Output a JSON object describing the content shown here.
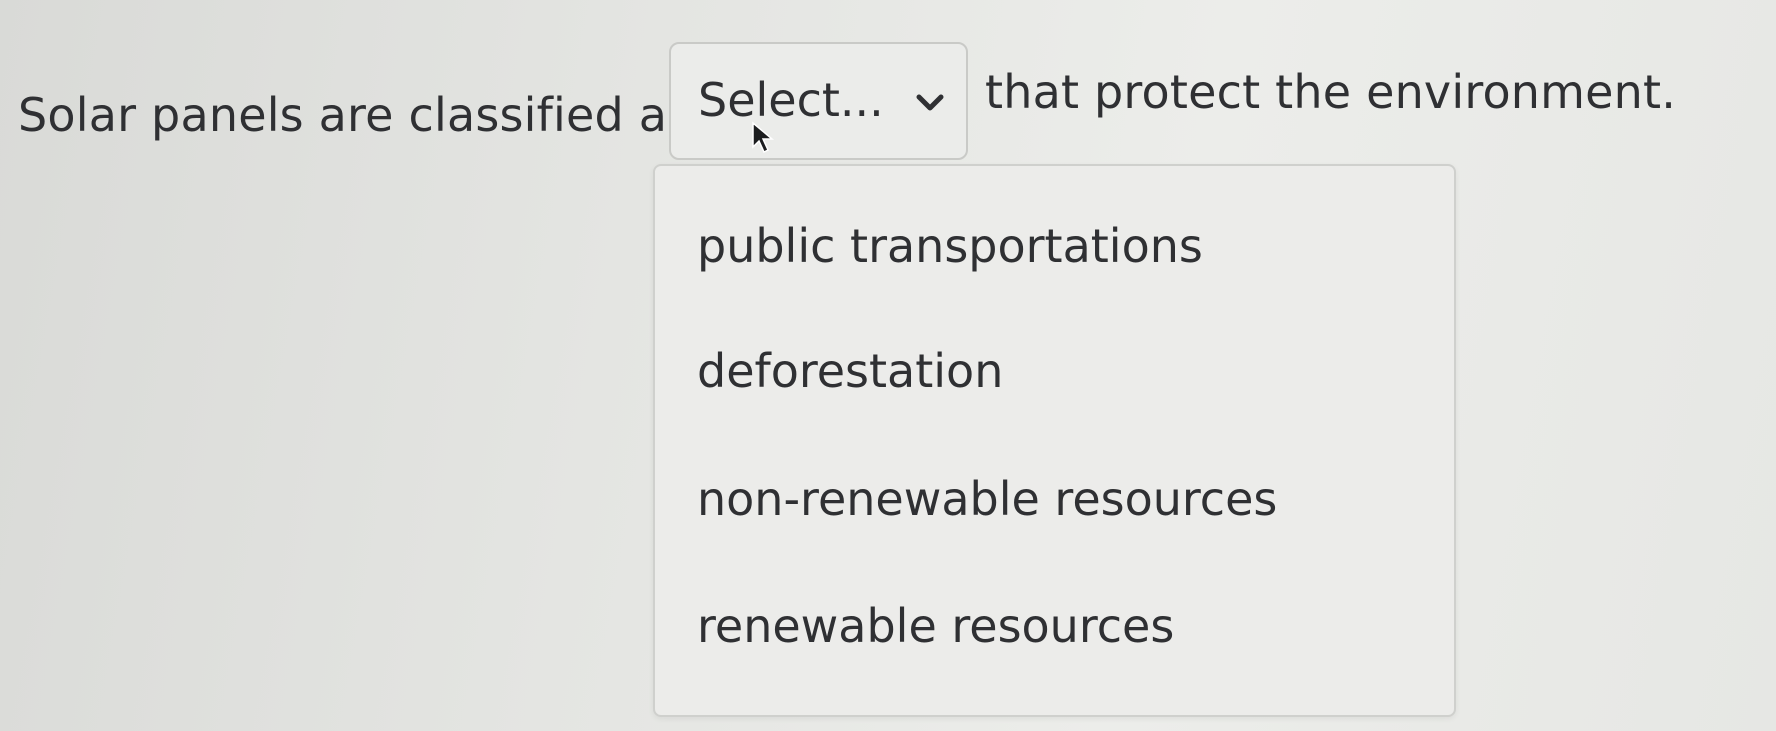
{
  "question": {
    "prefix": "Solar panels are classified as",
    "suffix": "that protect the environment."
  },
  "select": {
    "label": "Select...",
    "icon": "chevron-down-icon"
  },
  "dropdown": {
    "options": [
      "public transportations",
      "deforestation",
      "non-renewable resources",
      "renewable resources"
    ]
  }
}
